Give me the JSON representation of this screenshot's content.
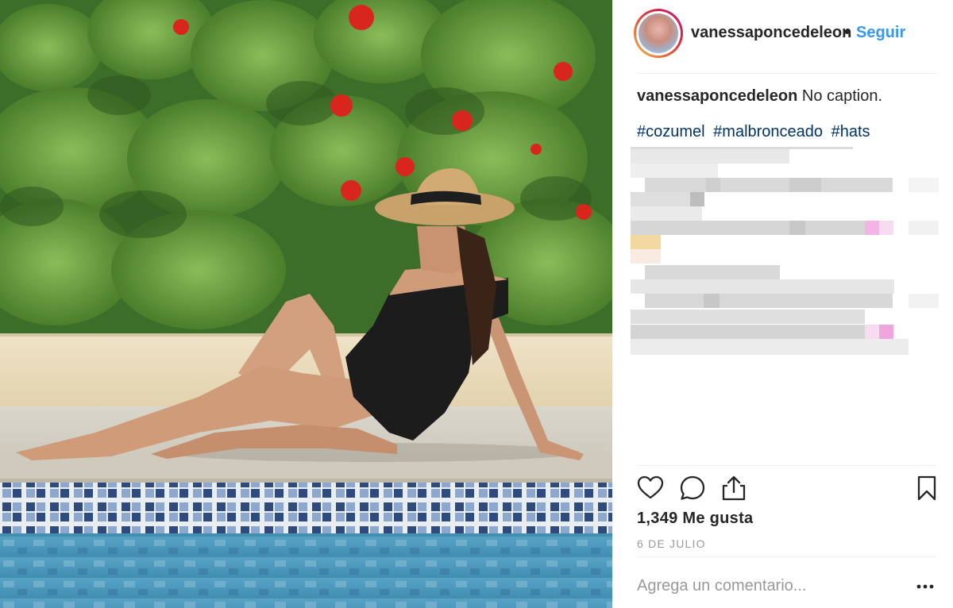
{
  "header": {
    "username": "vanessaponcedeleon",
    "separator": "•",
    "follow_label": "Seguir"
  },
  "caption": {
    "username": "vanessaponcedeleon",
    "text": "No caption.",
    "hashtags": [
      "#cozumel",
      "#malbronceado",
      "#hats"
    ]
  },
  "actions": {
    "icons": [
      "heart-icon",
      "comment-icon",
      "share-icon",
      "bookmark-icon"
    ]
  },
  "likes_label": "1,349 Me gusta",
  "date_label": "6 DE JULIO",
  "comment": {
    "placeholder": "Agrega un comentario...",
    "more_icon": "more-options-icon"
  },
  "colors": {
    "link": "#3897f0",
    "hashtag": "#003569",
    "text": "#262626",
    "muted": "#999999"
  }
}
